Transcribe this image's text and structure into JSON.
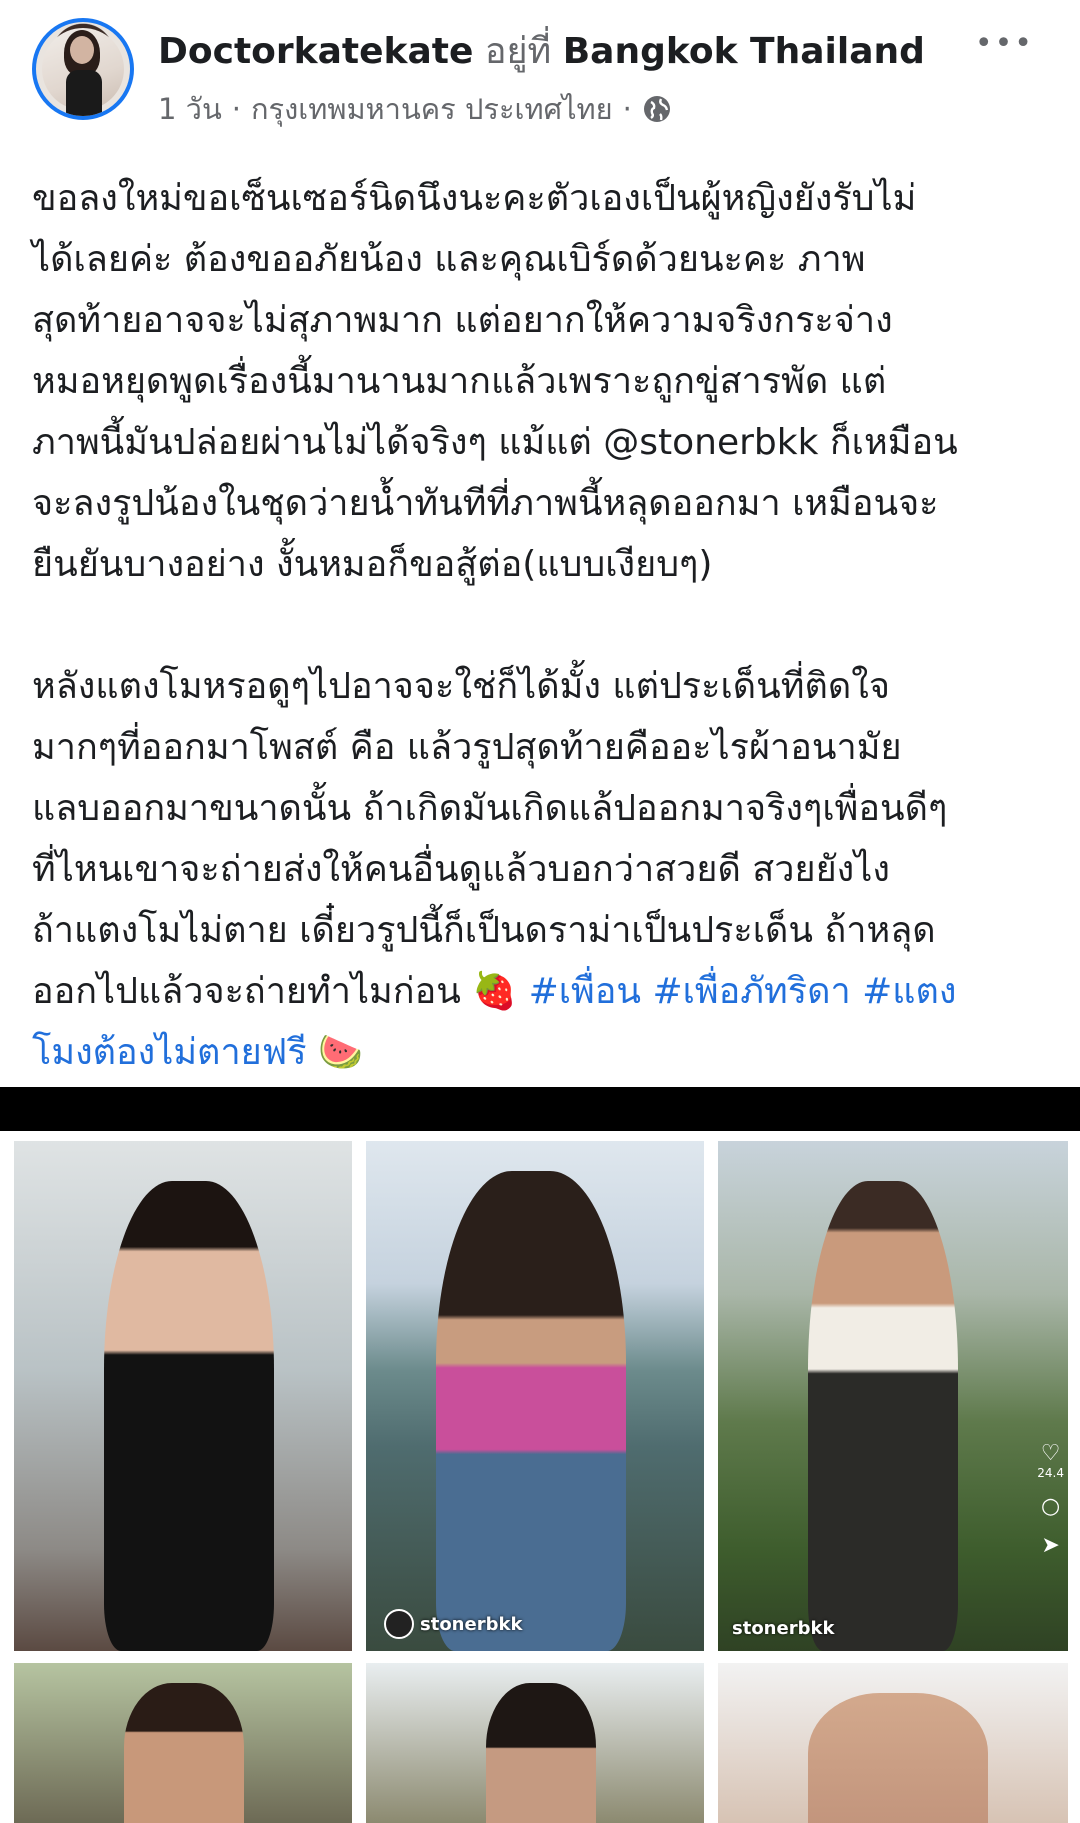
{
  "post": {
    "author": "Doctorkatekate",
    "location_prefix": "อยู่ที่",
    "location": "Bangkok Thailand",
    "time": "1 วัน",
    "separator": "·",
    "place": "กรุงเทพมหานคร ประเทศไทย",
    "separator2": "·",
    "privacy_icon": "globe-icon",
    "more_label": "•••"
  },
  "text": {
    "lines_p1": [
      "ขอลงใหม่ขอเซ็นเซอร์นิดนึงนะคะตัวเองเป็นผู้หญิงยังรับไม่",
      "ได้เลยค่ะ ต้องขออภัยน้อง และคุณเบิร์ดด้วยนะคะ ภาพ",
      "สุดท้ายอาจจะไม่สุภาพมาก แต่อยากให้ความจริงกระจ่าง",
      "หมอหยุดพูดเรื่องนี้มานานมากแล้วเพราะถูกขู่สารพัด แต่",
      "ภาพนี้มันปล่อยผ่านไม่ได้จริงๆ แม้แต่ @stonerbkk ก็เหมือน",
      "จะลงรูปน้องในชุดว่ายน้ำทันทีที่ภาพนี้หลุดออกมา เหมือนจะ",
      "ยืนยันบางอย่าง งั้นหมอก็ขอสู้ต่อ(แบบเงียบๆ)"
    ],
    "lines_p2": [
      "หลังแตงโมหรอดูๆไปอาจจะใช่ก็ได้มั้ง แต่ประเด็นที่ติดใจ",
      "มากๆที่ออกมาโพสต์ คือ แล้วรูปสุดท้ายคืออะไรผ้าอนามัย",
      "แลบออกมาขนาดนั้น ถ้าเกิดมันเกิดแล้ปออกมาจริงๆเพื่อนดีๆ",
      "ที่ไหนเขาจะถ่ายส่งให้คนอื่นดูแล้วบอกว่าสวยดี สวยยังไง",
      "ถ้าแตงโมไม่ตาย เดี๋ยวรูปนี้ก็เป็นดราม่าเป็นประเด็น ถ้าหลุด"
    ],
    "p2_last_plain": "ออกไปแล้วจะถ่ายทำไมก่อน",
    "emoji_strawberry": "🍓",
    "tag1": "#เพื่อน",
    "tag2": "#เพื่อภัทริดา",
    "tag3_part1": "#แตง",
    "tag3_part2": "โมงต้องไม่ตายฟรี",
    "emoji_watermelon": "🍉"
  },
  "photos": {
    "watermark2": "stonerbkk",
    "watermark3": "stonerbkk",
    "side_count": "24.4"
  },
  "colors": {
    "accent": "#1877f2",
    "hashtag": "#216fdb",
    "secondary_text": "#65676b"
  }
}
